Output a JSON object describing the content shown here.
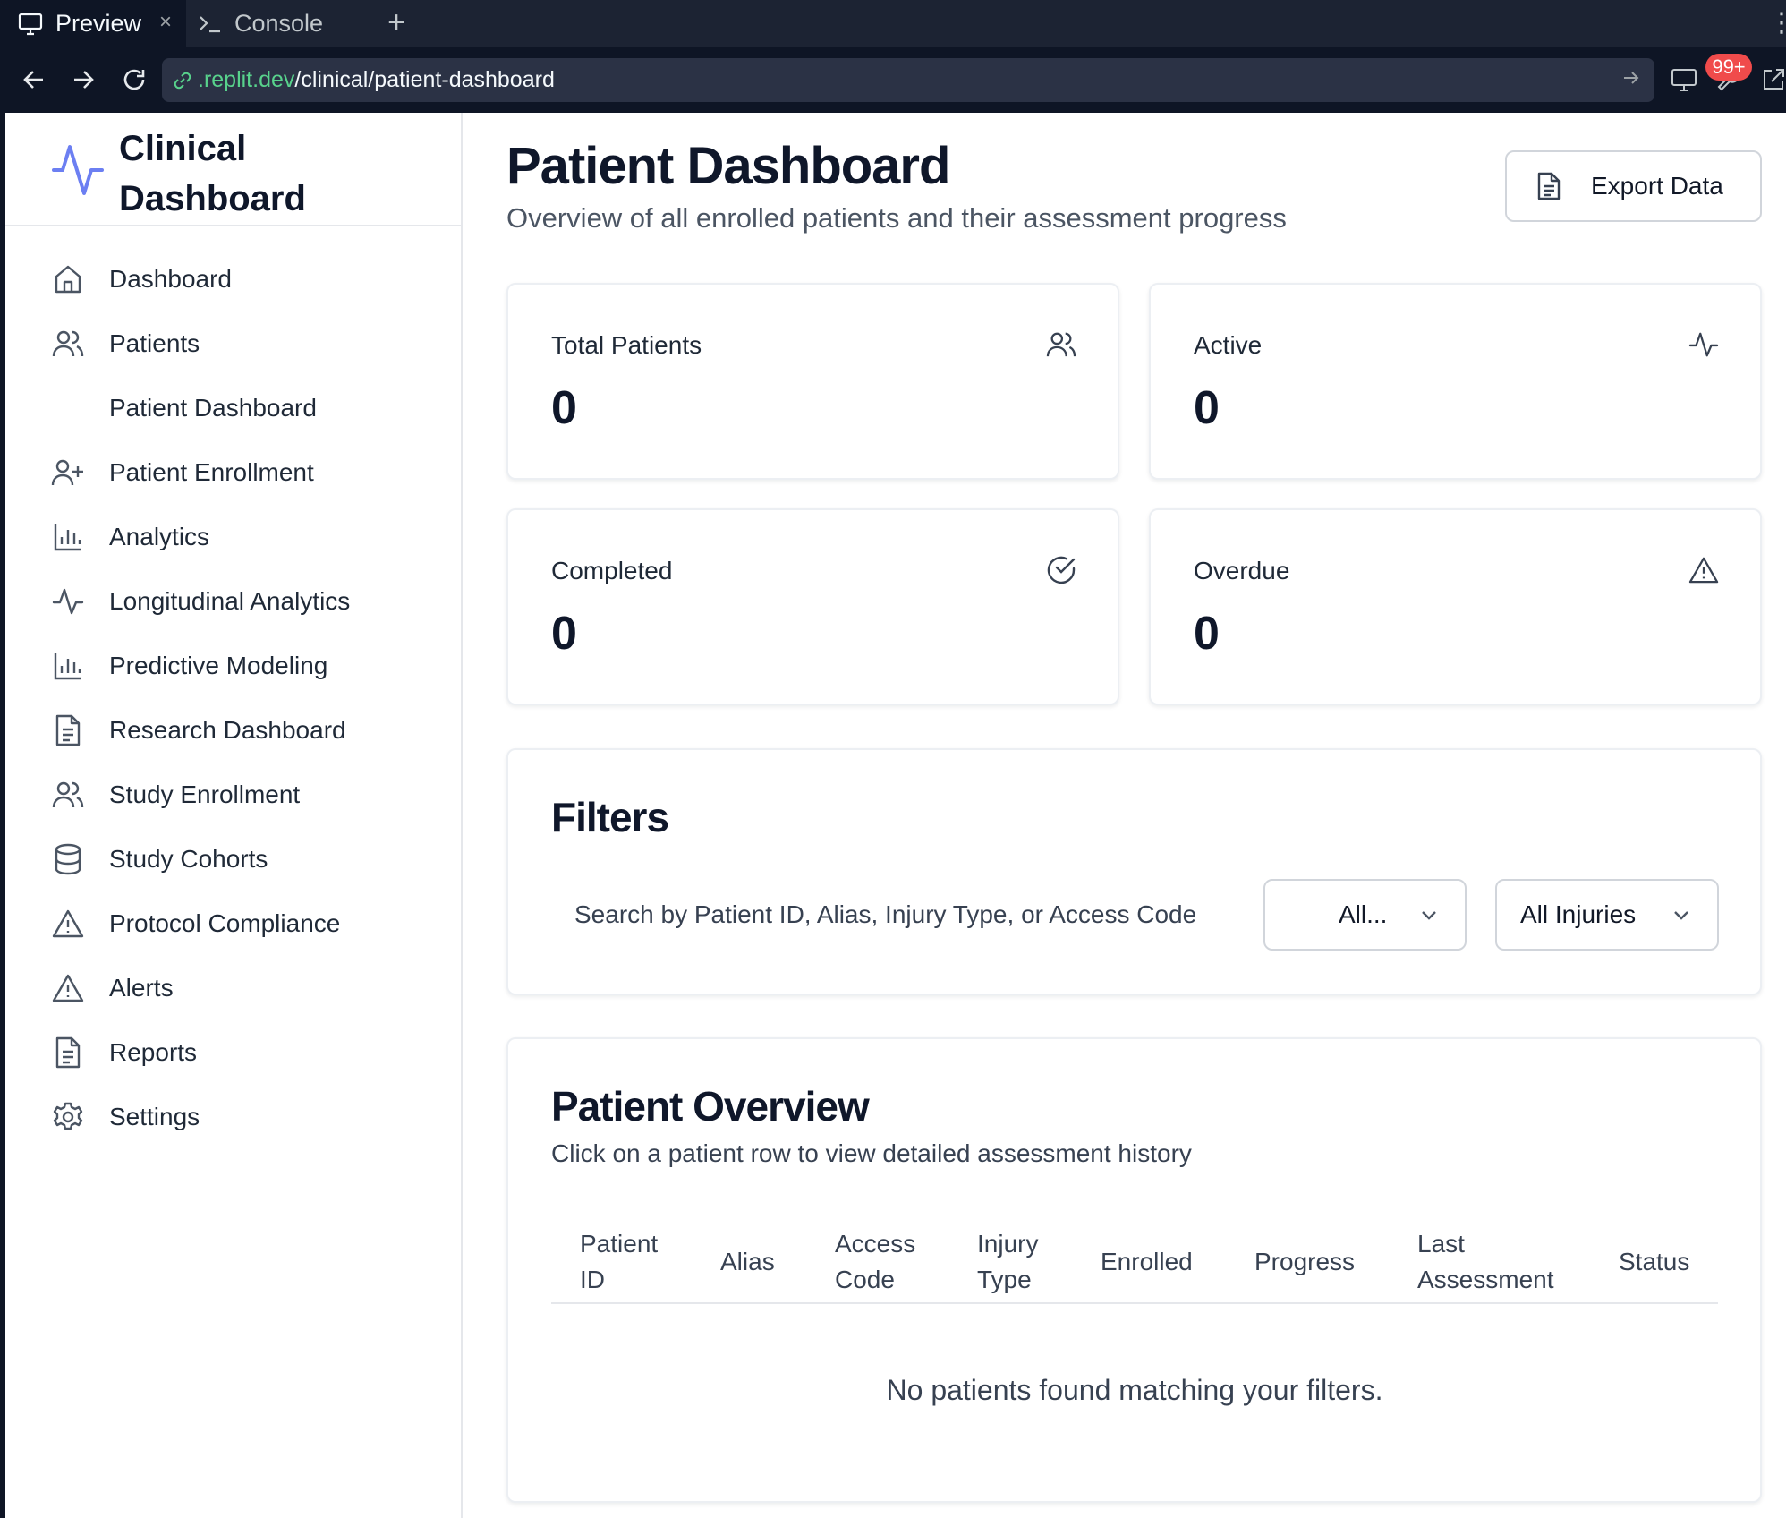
{
  "browser": {
    "tabs": [
      {
        "label": "Preview",
        "icon": "monitor-icon",
        "active": true
      },
      {
        "label": "Console",
        "icon": "terminal-icon",
        "active": false
      }
    ],
    "close_glyph": "×",
    "add_glyph": "+",
    "url": {
      "host": ".replit.dev",
      "path": "/clinical/patient-dashboard"
    },
    "notification_badge": "99+"
  },
  "sidebar": {
    "title": "Clinical Dashboard",
    "logo_icon": "activity-icon",
    "items": [
      {
        "label": "Dashboard",
        "icon": "home-icon"
      },
      {
        "label": "Patients",
        "icon": "users-icon"
      },
      {
        "label": "Patient Dashboard",
        "icon": ""
      },
      {
        "label": "Patient Enrollment",
        "icon": "user-plus-icon"
      },
      {
        "label": "Analytics",
        "icon": "bar-chart-icon"
      },
      {
        "label": "Longitudinal Analytics",
        "icon": "activity-icon"
      },
      {
        "label": "Predictive Modeling",
        "icon": "bar-chart-icon"
      },
      {
        "label": "Research Dashboard",
        "icon": "file-text-icon"
      },
      {
        "label": "Study Enrollment",
        "icon": "users-icon"
      },
      {
        "label": "Study Cohorts",
        "icon": "database-icon"
      },
      {
        "label": "Protocol Compliance",
        "icon": "alert-triangle-icon"
      },
      {
        "label": "Alerts",
        "icon": "alert-triangle-icon"
      },
      {
        "label": "Reports",
        "icon": "file-text-icon"
      },
      {
        "label": "Settings",
        "icon": "gear-icon"
      }
    ]
  },
  "header": {
    "title": "Patient Dashboard",
    "subtitle": "Overview of all enrolled patients and their assessment progress",
    "export_label": "Export Data"
  },
  "stats": [
    {
      "label": "Total Patients",
      "value": "0",
      "icon": "users-icon"
    },
    {
      "label": "Active",
      "value": "0",
      "icon": "activity-icon"
    },
    {
      "label": "Completed",
      "value": "0",
      "icon": "check-circle-icon"
    },
    {
      "label": "Overdue",
      "value": "0",
      "icon": "alert-triangle-icon"
    }
  ],
  "filters": {
    "title": "Filters",
    "search_placeholder": "Search by Patient ID, Alias, Injury Type, or Access Code",
    "status_select": "All...",
    "injury_select": "All Injuries"
  },
  "overview": {
    "title": "Patient Overview",
    "subtitle": "Click on a patient row to view detailed assessment history",
    "columns": [
      {
        "line1": "Patient",
        "line2": "ID"
      },
      {
        "line1": "Alias",
        "line2": ""
      },
      {
        "line1": "Access",
        "line2": "Code"
      },
      {
        "line1": "Injury",
        "line2": "Type"
      },
      {
        "line1": "Enrolled",
        "line2": ""
      },
      {
        "line1": "Progress",
        "line2": ""
      },
      {
        "line1": "Last",
        "line2": "Assessment"
      },
      {
        "line1": "Status",
        "line2": ""
      }
    ],
    "empty_message": "No patients found matching your filters."
  }
}
